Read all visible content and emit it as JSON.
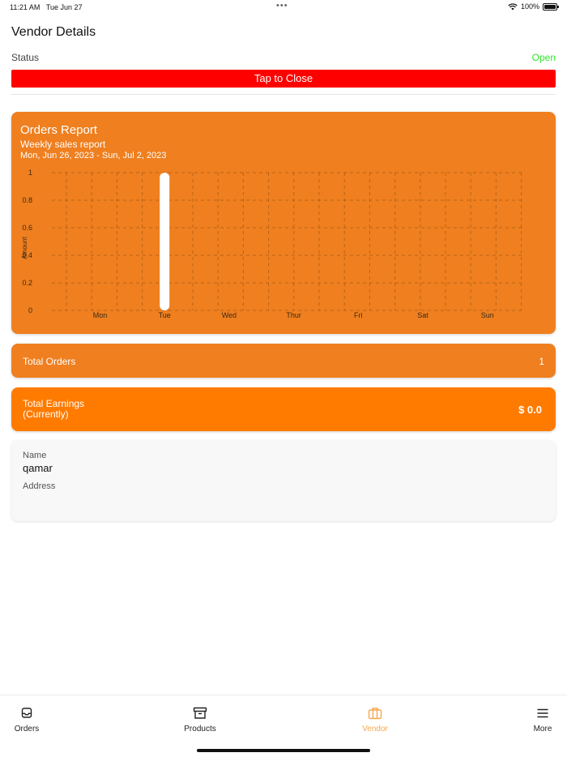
{
  "status_bar": {
    "time": "11:21 AM",
    "date": "Tue Jun 27",
    "battery": "100%"
  },
  "page": {
    "title": "Vendor Details"
  },
  "status": {
    "label": "Status",
    "value": "Open",
    "value_color": "#2ee62e"
  },
  "close_button": {
    "label": "Tap to Close",
    "color": "#ff0000"
  },
  "report": {
    "title": "Orders Report",
    "subtitle": "Weekly sales report",
    "range": "Mon, Jun 26, 2023  -  Sun, Jul 2, 2023",
    "color": "#ef7f1f"
  },
  "chart_data": {
    "type": "bar",
    "categories": [
      "Mon",
      "Tue",
      "Wed",
      "Thur",
      "Fri",
      "Sat",
      "Sun"
    ],
    "values": [
      0,
      1,
      0,
      0,
      0,
      0,
      0
    ],
    "ylabel": "Amount",
    "ylim": [
      0,
      1
    ],
    "yticks": [
      "0",
      "0.2",
      "0.4",
      "0.6",
      "0.8",
      "1"
    ],
    "grid": true
  },
  "total_orders": {
    "label": "Total Orders",
    "value": "1"
  },
  "total_earnings": {
    "label_line1": "Total Earnings",
    "label_line2": "(Currently)",
    "value": "$ 0.0",
    "color": "#ff7b00"
  },
  "vendor_info": {
    "name_label": "Name",
    "name_value": "qamar",
    "address_label": "Address"
  },
  "tabs": [
    {
      "label": "Orders",
      "icon": "inbox-icon"
    },
    {
      "label": "Products",
      "icon": "archive-box-icon"
    },
    {
      "label": "Vendor",
      "icon": "briefcase-icon",
      "active": true,
      "active_color": "#f5a84e"
    },
    {
      "label": "More",
      "icon": "menu-icon"
    }
  ]
}
